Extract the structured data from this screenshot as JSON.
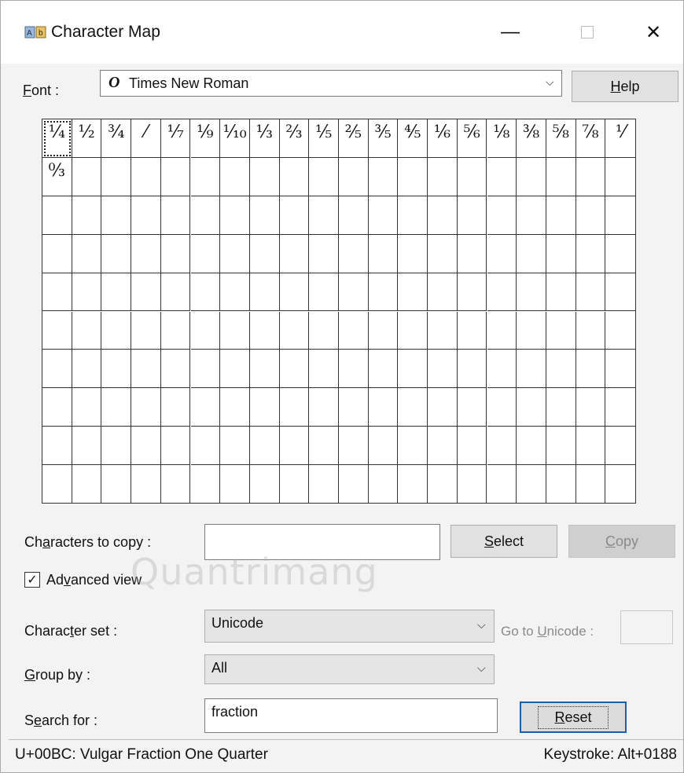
{
  "window": {
    "title": "Character Map",
    "minimize_glyph": "—",
    "close_glyph": "✕"
  },
  "font": {
    "label_prefix": "",
    "label_ul": "F",
    "label_rest": "ont :",
    "icon_glyph": "O",
    "value": "Times New Roman",
    "chevron": "⌵"
  },
  "help_button": {
    "ul": "H",
    "rest": "elp"
  },
  "grid": {
    "row1": [
      "¼",
      "½",
      "¾",
      "⁄",
      "⅐",
      "⅑",
      "⅒",
      "⅓",
      "⅔",
      "⅕",
      "⅖",
      "⅗",
      "⅘",
      "⅙",
      "⅚",
      "⅛",
      "⅜",
      "⅝",
      "⅞",
      "⅟"
    ],
    "row2": [
      "↉"
    ],
    "selected_index": 0
  },
  "copy_section": {
    "label_pre": "Ch",
    "label_ul": "a",
    "label_post": "racters to copy :",
    "input_value": "",
    "select_ul": "S",
    "select_rest": "elect",
    "copy_ul": "C",
    "copy_rest": "opy"
  },
  "advanced_view": {
    "checked_glyph": "✓",
    "label_pre": "Ad",
    "label_ul": "v",
    "label_post": "anced view"
  },
  "character_set": {
    "label_pre": "Charac",
    "label_ul": "t",
    "label_post": "er set :",
    "value": "Unicode"
  },
  "goto_unicode": {
    "label_pre": "Go to ",
    "label_ul": "U",
    "label_post": "nicode :",
    "value": ""
  },
  "group_by": {
    "label_ul": "G",
    "label_post": "roup by :",
    "value": "All"
  },
  "search": {
    "label_pre": "S",
    "label_ul": "e",
    "label_post": "arch for :",
    "value": "fraction",
    "reset_ul": "R",
    "reset_rest": "eset"
  },
  "status": {
    "char_info": "U+00BC: Vulgar Fraction One Quarter",
    "keystroke": "Keystroke: Alt+0188"
  },
  "watermark": "Quantrimang"
}
